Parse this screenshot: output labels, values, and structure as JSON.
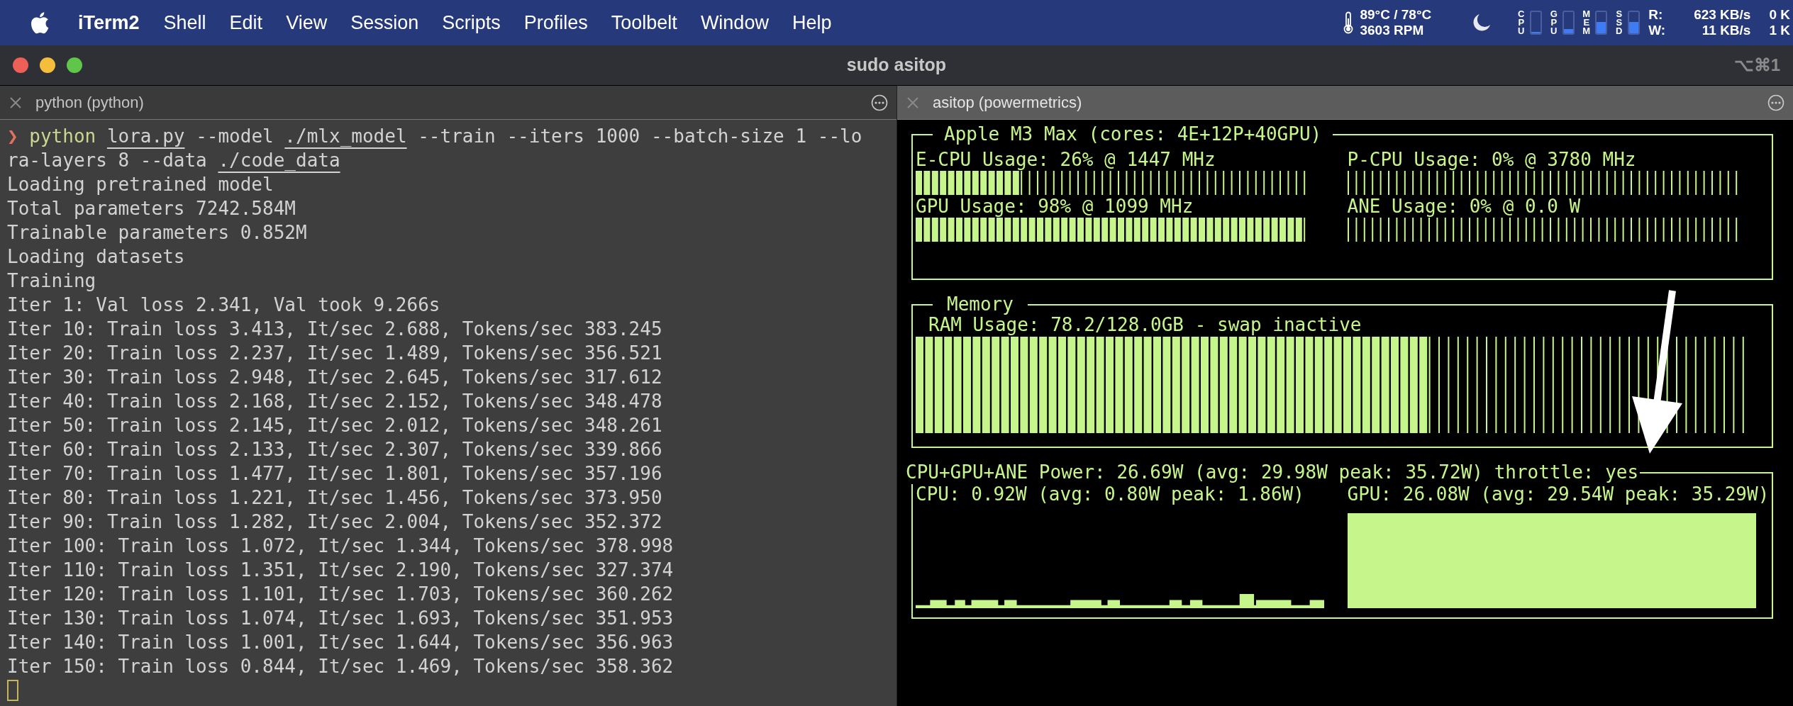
{
  "menu_bar": {
    "app": "iTerm2",
    "items": [
      "Shell",
      "Edit",
      "View",
      "Session",
      "Scripts",
      "Profiles",
      "Toolbelt",
      "Window",
      "Help"
    ],
    "status": {
      "temperature": "89°C / 78°C",
      "fan": "3603 RPM",
      "meters": [
        {
          "label": "CPU",
          "level": 0.06
        },
        {
          "label": "GPU",
          "level": 0.2
        },
        {
          "label": "MEM",
          "level": 0.55
        },
        {
          "label": "SSD",
          "level": 0.55
        }
      ],
      "disk": {
        "read_label": "R:",
        "read": "623 KB/s",
        "write_label": "W:",
        "write": "11 KB/s"
      },
      "network": [
        "0 K",
        "1 K"
      ]
    }
  },
  "window": {
    "title": "sudo asitop",
    "shortcut": "⌥⌘1"
  },
  "tabs": [
    {
      "label": "python (python)",
      "selected": false
    },
    {
      "label": "asitop (powermetrics)",
      "selected": true
    }
  ],
  "terminal": {
    "prompt": "❯",
    "command": [
      {
        "text": "python",
        "kind": "program"
      },
      {
        "text": "lora.py",
        "kind": "path"
      },
      {
        "text": "--model",
        "kind": "plain"
      },
      {
        "text": "./mlx_model",
        "kind": "path"
      },
      {
        "text": "--train --iters 1000 --batch-size 1 --lora-layers 8 --data",
        "kind": "plain"
      },
      {
        "text": "./code_data",
        "kind": "path"
      }
    ],
    "output": [
      "Loading pretrained model",
      "Total parameters 7242.584M",
      "Trainable parameters 0.852M",
      "Loading datasets",
      "Training",
      "Iter 1: Val loss 2.341, Val took 9.266s",
      "Iter 10: Train loss 3.413, It/sec 2.688, Tokens/sec 383.245",
      "Iter 20: Train loss 2.237, It/sec 1.489, Tokens/sec 356.521",
      "Iter 30: Train loss 2.948, It/sec 2.645, Tokens/sec 317.612",
      "Iter 40: Train loss 2.168, It/sec 2.152, Tokens/sec 348.478",
      "Iter 50: Train loss 2.145, It/sec 2.012, Tokens/sec 348.261",
      "Iter 60: Train loss 2.133, It/sec 2.307, Tokens/sec 339.866",
      "Iter 70: Train loss 1.477, It/sec 1.801, Tokens/sec 357.196",
      "Iter 80: Train loss 1.221, It/sec 1.456, Tokens/sec 373.950",
      "Iter 90: Train loss 1.282, It/sec 2.004, Tokens/sec 352.372",
      "Iter 100: Train loss 1.072, It/sec 1.344, Tokens/sec 378.998",
      "Iter 110: Train loss 1.351, It/sec 2.190, Tokens/sec 327.374",
      "Iter 120: Train loss 1.101, It/sec 1.703, Tokens/sec 360.262",
      "Iter 130: Train loss 1.074, It/sec 1.693, Tokens/sec 351.953",
      "Iter 140: Train loss 1.001, It/sec 1.644, Tokens/sec 356.963",
      "Iter 150: Train loss 0.844, It/sec 1.469, Tokens/sec 358.362"
    ]
  },
  "asitop": {
    "processor": {
      "title": "Apple M3 Max (cores: 4E+12P+40GPU)",
      "gauges": [
        {
          "label": "E-CPU Usage: 26% @ 1447 MHz",
          "level": 0.26
        },
        {
          "label": "P-CPU Usage: 0% @ 3780 MHz",
          "level": 0
        },
        {
          "label": "GPU Usage: 98% @ 1099 MHz",
          "level": 0.98
        },
        {
          "label": "ANE Usage: 0% @ 0.0 W",
          "level": 0
        }
      ]
    },
    "memory": {
      "title": "Memory",
      "label": "RAM Usage: 78.2/128.0GB - swap inactive",
      "level": 0.61
    },
    "power": {
      "title": "CPU+GPU+ANE Power: 26.69W (avg: 29.98W peak: 35.72W) throttle: yes",
      "cpu_label": "CPU: 0.92W (avg: 0.80W peak: 1.86W)",
      "gpu_label": "GPU: 26.08W (avg: 29.54W peak: 35.29W)"
    }
  }
}
